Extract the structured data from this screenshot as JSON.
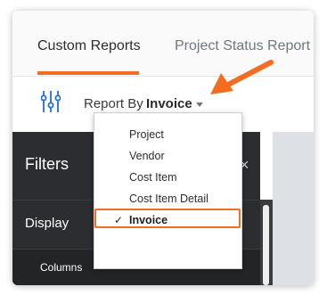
{
  "tabs": [
    {
      "label": "Custom Reports",
      "active": true
    },
    {
      "label": "Project Status Report",
      "active": false
    }
  ],
  "report_by": {
    "label": "Report By",
    "value": "Invoice",
    "icon": "sliders-icon"
  },
  "dropdown": {
    "items": [
      {
        "label": "Project",
        "selected": false
      },
      {
        "label": "Vendor",
        "selected": false
      },
      {
        "label": "Cost Item",
        "selected": false
      },
      {
        "label": "Cost Item Detail",
        "selected": false
      },
      {
        "label": "Invoice",
        "selected": true
      }
    ],
    "check_glyph": "✓"
  },
  "filters": {
    "title": "Filters",
    "close_glyph": "×",
    "display_label": "Display",
    "columns_label": "Columns",
    "chevron_glyph": "▸"
  },
  "colors": {
    "accent": "#f36c21",
    "dark_panel": "#222426",
    "icon_blue": "#1e6fd9"
  }
}
